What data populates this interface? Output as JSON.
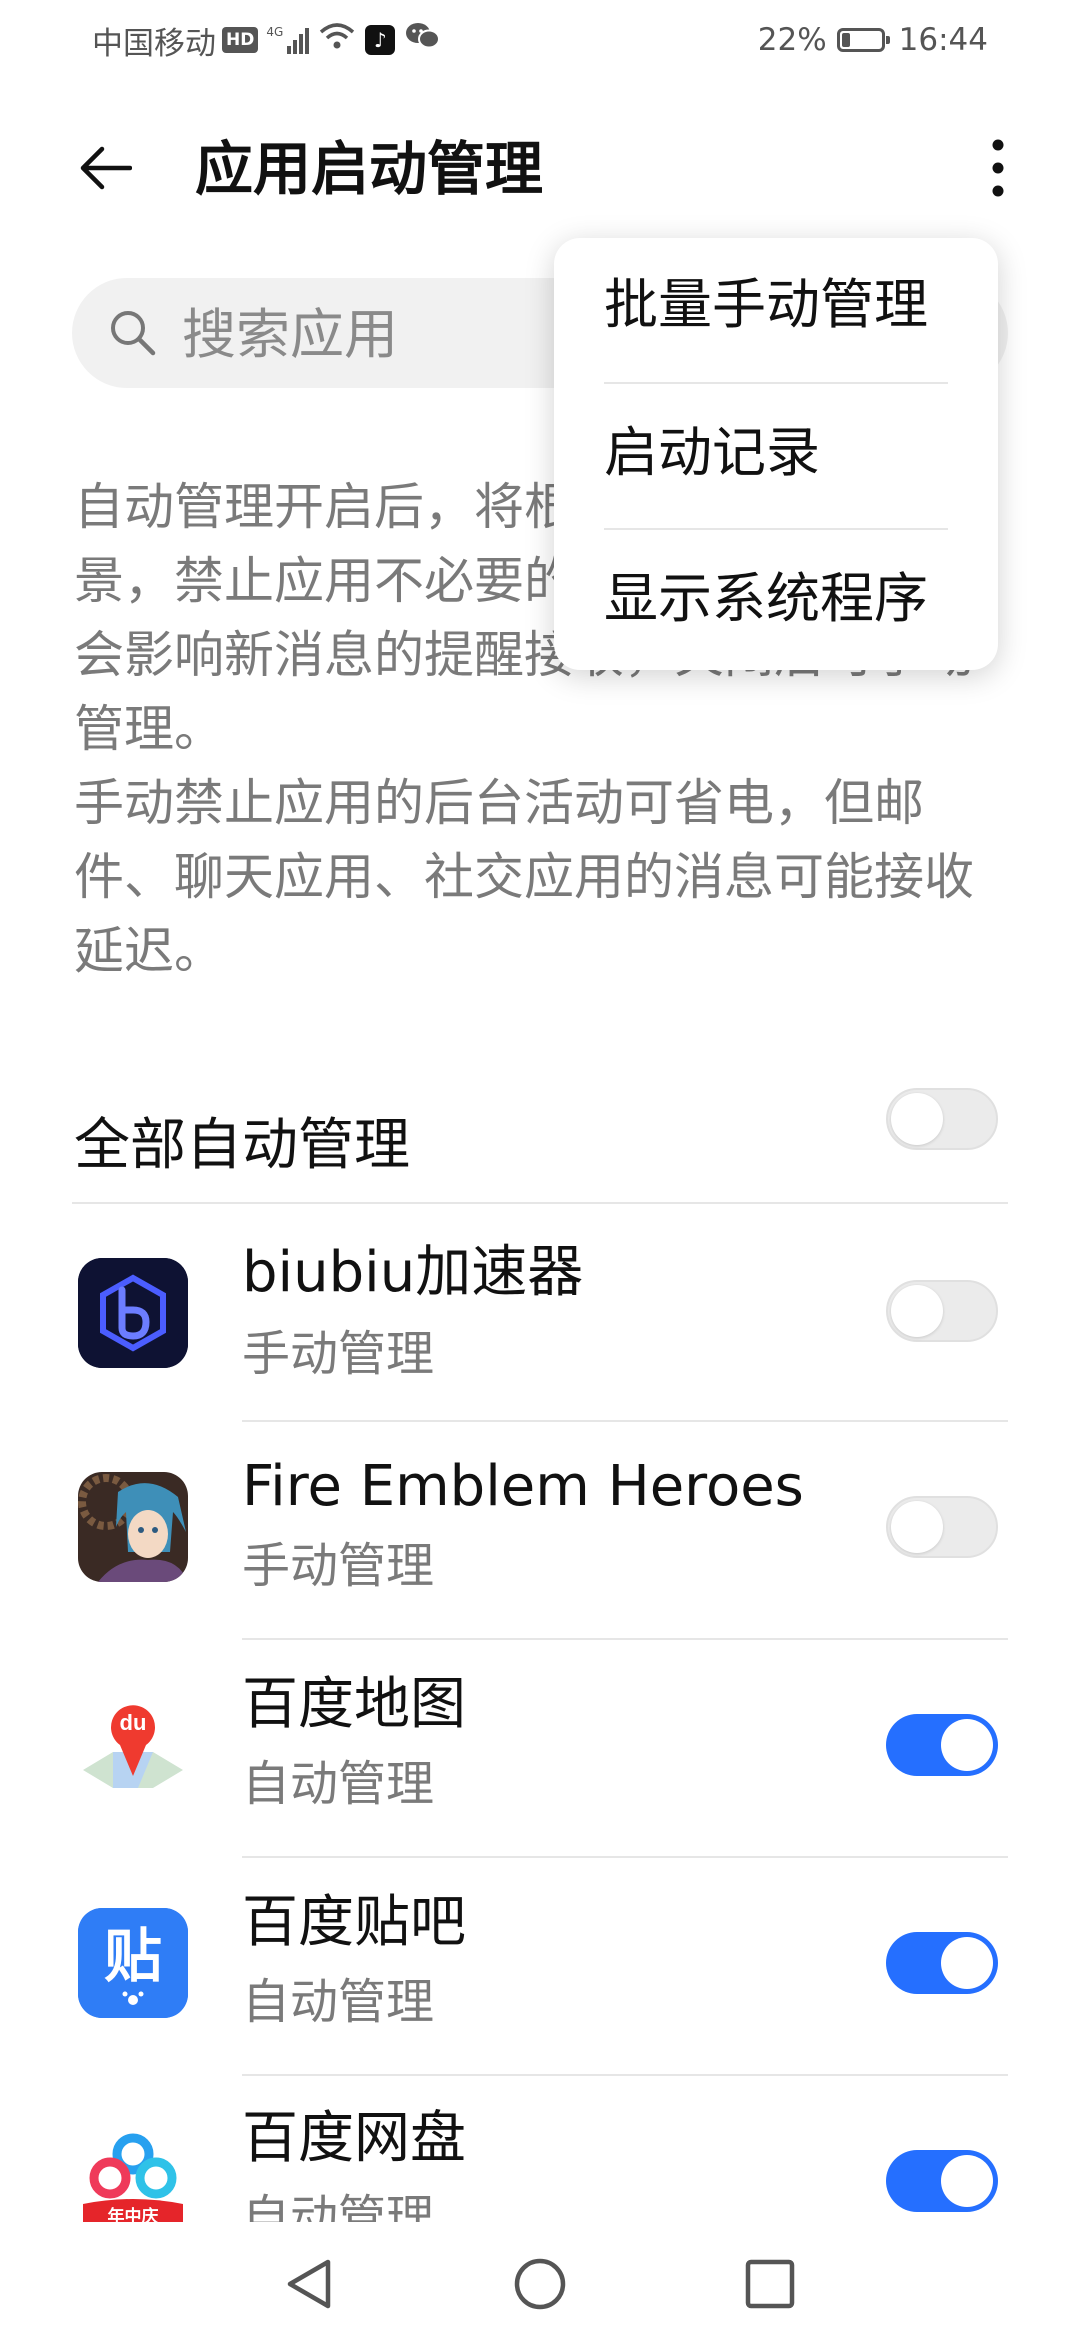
{
  "status_bar": {
    "carrier": "中国移动",
    "hd": "HD",
    "network": "4G",
    "battery_text": "22%",
    "battery_level": 0.22,
    "time": "16:44"
  },
  "header": {
    "title": "应用启动管理"
  },
  "search": {
    "placeholder": "搜索应用"
  },
  "description": {
    "paragraph1": "自动管理开启后，将根据应用的使用场景，禁止应用不必要的后台活动，设置不会影响新消息的提醒接收，关闭后可手动管理。",
    "paragraph2": "手动禁止应用的后台活动可省电，但邮件、聊天应用、社交应用的消息可能接收延迟。"
  },
  "all_auto": {
    "label": "全部自动管理",
    "enabled": false
  },
  "apps": [
    {
      "name": "biubiu加速器",
      "status": "手动管理",
      "enabled": false,
      "icon": "biubiu-icon"
    },
    {
      "name": "Fire Emblem Heroes",
      "status": "手动管理",
      "enabled": false,
      "icon": "fire-emblem-heroes-icon"
    },
    {
      "name": "百度地图",
      "status": "自动管理",
      "enabled": true,
      "icon": "baidu-map-icon"
    },
    {
      "name": "百度贴吧",
      "status": "自动管理",
      "enabled": true,
      "icon": "baidu-tieba-icon"
    },
    {
      "name": "百度网盘",
      "status": "自动管理",
      "enabled": true,
      "icon": "baidu-netdisk-icon"
    }
  ],
  "icon_text": {
    "du": "du",
    "tie": "贴",
    "netdisk_badge": "年中庆"
  },
  "menu": {
    "items": [
      "批量手动管理",
      "启动记录",
      "显示系统程序"
    ]
  },
  "colors": {
    "accent": "#256FFF",
    "text_primary": "#111111",
    "text_secondary": "#7A7A7A"
  }
}
